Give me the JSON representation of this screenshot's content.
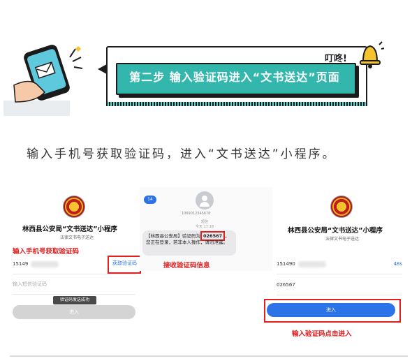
{
  "banner": {
    "step_text": "第二步 输入验证码进入“文书送达”页面",
    "dingdong": "叮咚!"
  },
  "instruction": "输入手机号获取验证码，进入“文书送达”小程序。",
  "left_panel": {
    "title": "林西县公安局“文书送达”小程序",
    "subtitle": "法律文书电子送达",
    "annotation": "输入手机号获取验证码",
    "phone_prefix": "15149",
    "get_code_label": "获取验证码",
    "code_placeholder": "输入短信验证码",
    "toast": "验证码发送成功",
    "enter_label": "进入"
  },
  "middle_panel": {
    "back_badge": "14",
    "sender": "1069012345678",
    "msg_meta_line1": "短信",
    "msg_meta_line2": "今天 17:18",
    "message_prefix": "【林西县公安局】验证码为",
    "message_code": "026567",
    "message_rest": "，您正在登录，若非本人操作，请勿泄露。",
    "annotation": "接收验证码信息"
  },
  "right_panel": {
    "title": "林西县公安局“文书送达”小程序",
    "subtitle": "法律文书电子送达",
    "phone_prefix": "151490",
    "countdown": "48s",
    "code_value": "026567",
    "enter_label": "进入",
    "annotation": "输入验证码点击进入"
  },
  "colors": {
    "accent_teal": "#33b7ad",
    "annotation_red": "#e02020",
    "button_blue": "#2c73e8"
  }
}
